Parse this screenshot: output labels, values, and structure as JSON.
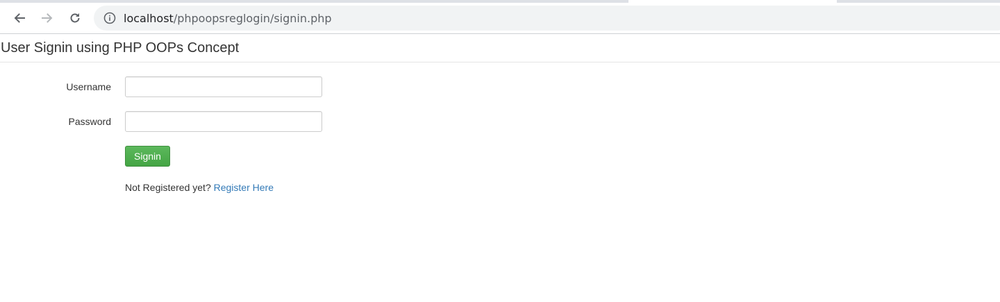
{
  "browser": {
    "url_host": "localhost",
    "url_path": "/phpoopsreglogin/signin.php",
    "icons": {
      "back": "arrow-left-icon",
      "forward": "arrow-right-icon",
      "reload": "reload-icon",
      "site_info": "info-icon"
    }
  },
  "page": {
    "title": "User Signin using PHP OOPs Concept"
  },
  "form": {
    "username_label": "Username",
    "username_value": "",
    "password_label": "Password",
    "password_value": "",
    "signin_label": "Signin",
    "register_prompt": "Not Registered yet?",
    "register_link": "Register Here"
  },
  "colors": {
    "signin_button": "#5cb85c",
    "link": "#337ab7"
  }
}
